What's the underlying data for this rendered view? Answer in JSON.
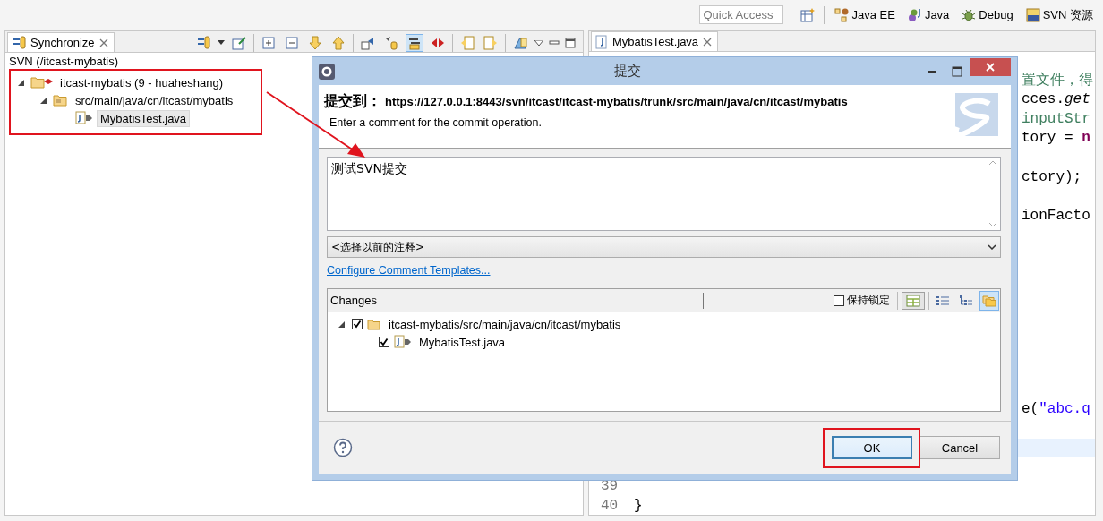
{
  "toolbar": {
    "quick_access": {
      "placeholder": "Quick Access"
    },
    "perspectives": [
      {
        "kind": "javaee",
        "label": "Java EE"
      },
      {
        "kind": "java",
        "label": "Java"
      },
      {
        "kind": "debug",
        "label": "Debug"
      },
      {
        "kind": "svn",
        "label": "SVN 资源"
      }
    ]
  },
  "sync_view": {
    "tab": {
      "label": "Synchronize",
      "selected": true
    },
    "modes": [
      {
        "kind": "incoming",
        "selected": false
      },
      {
        "kind": "outgoing",
        "selected": false
      },
      {
        "kind": "both",
        "selected": true
      },
      {
        "kind": "conflicts",
        "selected": false
      }
    ],
    "heading": "SVN (/itcast-mybatis)",
    "tree": [
      {
        "kind": "project",
        "label": "itcast-mybatis (9 - huaheshang)",
        "expanded": true,
        "selected": false,
        "children": [
          {
            "kind": "package",
            "label": "src/main/java/cn/itcast/mybatis",
            "expanded": true,
            "selected": false,
            "children": [
              {
                "kind": "java",
                "label": "MybatisTest.java",
                "selected": true
              }
            ]
          }
        ]
      }
    ]
  },
  "editor": {
    "tab": {
      "label": "MybatisTest.java",
      "selected": true
    },
    "lines": [
      {
        "kind": "hidden"
      },
      {
        "kind": "fragment",
        "segments": [
          {
            "kind": "comment",
            "text": "置文件，得"
          }
        ]
      },
      {
        "kind": "fragment",
        "segments": [
          {
            "kind": "plain",
            "text": "cces."
          },
          {
            "kind": "method",
            "text": "get"
          }
        ]
      },
      {
        "kind": "fragment",
        "segments": [
          {
            "kind": "comment",
            "text": "inputStr"
          }
        ]
      },
      {
        "kind": "fragment",
        "segments": [
          {
            "kind": "plain",
            "text": "tory = "
          },
          {
            "kind": "keyword",
            "text": "n"
          }
        ]
      },
      {
        "kind": "hidden"
      },
      {
        "kind": "fragment",
        "segments": [
          {
            "kind": "plain",
            "text": "ctory);"
          }
        ]
      },
      {
        "kind": "hidden"
      },
      {
        "kind": "fragment",
        "segments": [
          {
            "kind": "plain",
            "text": "ionFacto"
          }
        ]
      },
      {
        "kind": "hidden"
      },
      {
        "kind": "hidden"
      },
      {
        "kind": "hidden"
      },
      {
        "kind": "hidden"
      },
      {
        "kind": "hidden"
      },
      {
        "kind": "hidden"
      },
      {
        "kind": "hidden"
      },
      {
        "kind": "hidden"
      },
      {
        "kind": "hidden"
      },
      {
        "kind": "fragment",
        "segments": [
          {
            "kind": "plain",
            "text": "e("
          },
          {
            "kind": "string",
            "text": "\"abc.q"
          }
        ]
      },
      {
        "kind": "hidden"
      },
      {
        "kind": "hidden",
        "current": true
      },
      {
        "kind": "hidden"
      },
      {
        "kind": "numbered",
        "number": "39"
      },
      {
        "kind": "numbered",
        "number": "40",
        "segments": [
          {
            "kind": "plain",
            "text": "}"
          }
        ]
      }
    ]
  },
  "dialog": {
    "title": "提交",
    "target_label": "提交到：",
    "url": "https://127.0.0.1:8443/svn/itcast/itcast-mybatis/trunk/src/main/java/cn/itcast/mybatis",
    "description": "Enter a comment for the commit operation.",
    "comment": {
      "value": "测试SVN提交"
    },
    "previous_comments": {
      "value": "<选择以前的注释>"
    },
    "link": "Configure Comment Templates...",
    "changes": {
      "title": "Changes",
      "keep_locks": {
        "label": "保持锁定",
        "checked": false
      },
      "layout_toggle": {
        "on": true
      },
      "view_modes": [
        {
          "kind": "flat",
          "selected": false
        },
        {
          "kind": "tree",
          "selected": false
        },
        {
          "kind": "compressed",
          "selected": true
        }
      ],
      "tree": [
        {
          "kind": "folder",
          "label": "itcast-mybatis/src/main/java/cn/itcast/mybatis",
          "checked": true,
          "expanded": true,
          "children": [
            {
              "kind": "java",
              "label": "MybatisTest.java",
              "checked": true
            }
          ]
        }
      ]
    },
    "buttons": [
      {
        "label": "OK",
        "default": true
      },
      {
        "label": "Cancel",
        "default": false
      }
    ]
  }
}
